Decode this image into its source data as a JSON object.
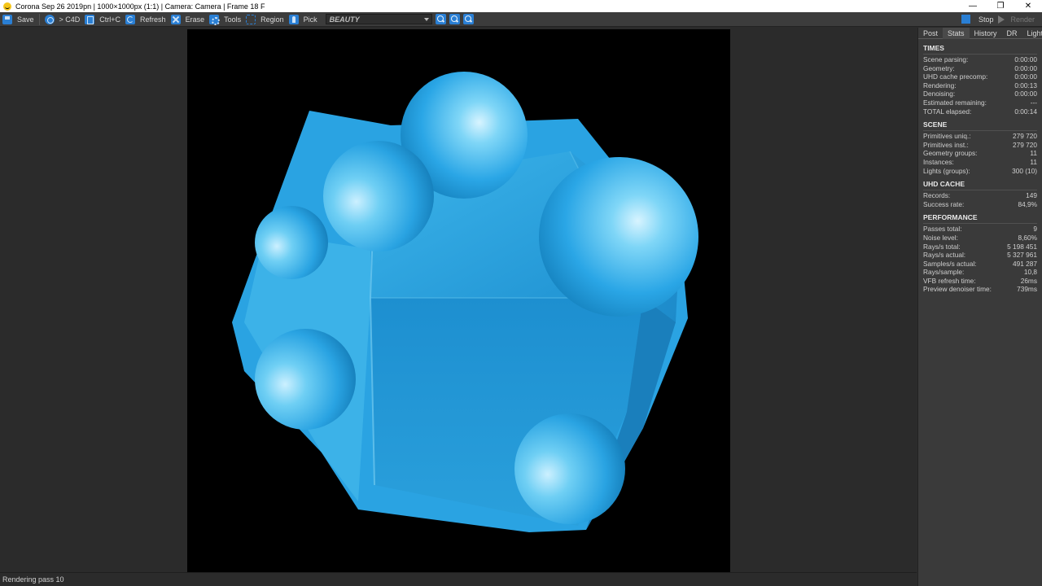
{
  "window": {
    "title": "Corona Sep 26 2019pn | 1000×1000px (1:1) | Camera: Camera | Frame 18 F",
    "minimize": "—",
    "maximize": "❐",
    "close": "✕"
  },
  "toolbar": {
    "save": "Save",
    "c4d": "> C4D",
    "copy": "Ctrl+C",
    "refresh": "Refresh",
    "erase": "Erase",
    "tools": "Tools",
    "region": "Region",
    "pick": "Pick",
    "channel": "BEAUTY",
    "stop": "Stop",
    "render": "Render"
  },
  "status": {
    "text": "Rendering pass 10"
  },
  "panel": {
    "tabs": [
      "Post",
      "Stats",
      "History",
      "DR",
      "LightMix"
    ],
    "active_tab": "Stats",
    "sections": [
      {
        "title": "TIMES",
        "rows": [
          {
            "label": "Scene parsing:",
            "value": "0:00:00"
          },
          {
            "label": "Geometry:",
            "value": "0:00:00"
          },
          {
            "label": "UHD cache precomp:",
            "value": "0:00:00"
          },
          {
            "label": "Rendering:",
            "value": "0:00:13"
          },
          {
            "label": "Denoising:",
            "value": "0:00:00"
          },
          {
            "label": "Estimated remaining:",
            "value": "---"
          },
          {
            "label": "TOTAL elapsed:",
            "value": "0:00:14"
          }
        ]
      },
      {
        "title": "SCENE",
        "rows": [
          {
            "label": "Primitives uniq.:",
            "value": "279 720"
          },
          {
            "label": "Primitives inst.:",
            "value": "279 720"
          },
          {
            "label": "Geometry groups:",
            "value": "11"
          },
          {
            "label": "Instances:",
            "value": "11"
          },
          {
            "label": "Lights (groups):",
            "value": "300 (10)"
          }
        ]
      },
      {
        "title": "UHD CACHE",
        "rows": [
          {
            "label": "Records:",
            "value": "149"
          },
          {
            "label": "Success rate:",
            "value": "84,9%"
          }
        ]
      },
      {
        "title": "PERFORMANCE",
        "rows": [
          {
            "label": "Passes total:",
            "value": "9"
          },
          {
            "label": "Noise level:",
            "value": "8,60%"
          },
          {
            "label": "Rays/s total:",
            "value": "5 198 451"
          },
          {
            "label": "Rays/s actual:",
            "value": "5 327 961"
          },
          {
            "label": "Samples/s actual:",
            "value": "491 287"
          },
          {
            "label": "Rays/sample:",
            "value": "10,8"
          },
          {
            "label": "VFB refresh time:",
            "value": "26ms"
          },
          {
            "label": "Preview denoiser time:",
            "value": "739ms"
          }
        ]
      }
    ]
  },
  "colors": {
    "accent": "#2a7fd4",
    "object_base": "#2aa6e6",
    "object_light": "#6fd0f5",
    "object_dark": "#1a7fb8"
  }
}
